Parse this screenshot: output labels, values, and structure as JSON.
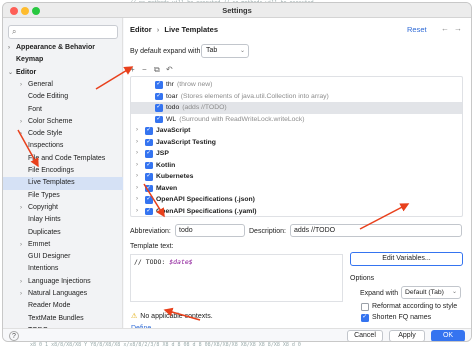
{
  "window": {
    "title": "Settings",
    "bg_top_text": "// no methods will be executed // so methods will be executed",
    "bg_bottom_text": "x8  0  1  x8/8/X8/X8 Y Y8/8/X8/X8  x/x8/8/2/3/8  X8 d 8 08 d 8 08/X8/X8/X8 X8/X8 X8 8/X8 X8 d 0"
  },
  "sidebar": {
    "search_placeholder": "",
    "items": [
      {
        "label": "Appearance & Behavior",
        "bold": true,
        "chevron": "›",
        "indent": 0
      },
      {
        "label": "Keymap",
        "bold": true,
        "chevron": "",
        "indent": 0
      },
      {
        "label": "Editor",
        "bold": true,
        "chevron": "⌄",
        "indent": 0
      },
      {
        "label": "General",
        "bold": false,
        "chevron": "›",
        "indent": 1
      },
      {
        "label": "Code Editing",
        "bold": false,
        "chevron": "",
        "indent": 1
      },
      {
        "label": "Font",
        "bold": false,
        "chevron": "",
        "indent": 1
      },
      {
        "label": "Color Scheme",
        "bold": false,
        "chevron": "›",
        "indent": 1
      },
      {
        "label": "Code Style",
        "bold": false,
        "chevron": "›",
        "indent": 1
      },
      {
        "label": "Inspections",
        "bold": false,
        "chevron": "",
        "indent": 1
      },
      {
        "label": "File and Code Templates",
        "bold": false,
        "chevron": "",
        "indent": 1
      },
      {
        "label": "File Encodings",
        "bold": false,
        "chevron": "",
        "indent": 1
      },
      {
        "label": "Live Templates",
        "bold": false,
        "chevron": "",
        "indent": 1,
        "selected": true
      },
      {
        "label": "File Types",
        "bold": false,
        "chevron": "",
        "indent": 1
      },
      {
        "label": "Copyright",
        "bold": false,
        "chevron": "›",
        "indent": 1
      },
      {
        "label": "Inlay Hints",
        "bold": false,
        "chevron": "",
        "indent": 1
      },
      {
        "label": "Duplicates",
        "bold": false,
        "chevron": "",
        "indent": 1
      },
      {
        "label": "Emmet",
        "bold": false,
        "chevron": "›",
        "indent": 1
      },
      {
        "label": "GUI Designer",
        "bold": false,
        "chevron": "",
        "indent": 1
      },
      {
        "label": "Intentions",
        "bold": false,
        "chevron": "",
        "indent": 1
      },
      {
        "label": "Language Injections",
        "bold": false,
        "chevron": "›",
        "indent": 1
      },
      {
        "label": "Natural Languages",
        "bold": false,
        "chevron": "›",
        "indent": 1
      },
      {
        "label": "Reader Mode",
        "bold": false,
        "chevron": "",
        "indent": 1
      },
      {
        "label": "TextMate Bundles",
        "bold": false,
        "chevron": "",
        "indent": 1
      },
      {
        "label": "TODO",
        "bold": false,
        "chevron": "",
        "indent": 1
      }
    ]
  },
  "main": {
    "breadcrumb_parent": "Editor",
    "breadcrumb_sep": "›",
    "breadcrumb_current": "Live Templates",
    "reset_label": "Reset",
    "expand_label": "By default expand with",
    "expand_value": "Tab",
    "toolbar": {
      "add": "+",
      "remove": "−",
      "copy": "⧉",
      "restore": "↶"
    },
    "templates": [
      {
        "kind": "item",
        "name": "thr",
        "desc": "(throw new)",
        "checked": true
      },
      {
        "kind": "item",
        "name": "toar",
        "desc": "(Stores elements of java.util.Collection into array)",
        "checked": true
      },
      {
        "kind": "item",
        "name": "todo",
        "desc": "(adds //TODO)",
        "checked": true,
        "selected": true
      },
      {
        "kind": "item",
        "name": "WL",
        "desc": "(Surround with ReadWriteLock.writeLock)",
        "checked": true
      },
      {
        "kind": "group",
        "name": "JavaScript",
        "checked": true
      },
      {
        "kind": "group",
        "name": "JavaScript Testing",
        "checked": true
      },
      {
        "kind": "group",
        "name": "JSP",
        "checked": true
      },
      {
        "kind": "group",
        "name": "Kotlin",
        "checked": true
      },
      {
        "kind": "group",
        "name": "Kubernetes",
        "checked": true
      },
      {
        "kind": "group",
        "name": "Maven",
        "checked": true
      },
      {
        "kind": "group",
        "name": "OpenAPI Specifications (.json)",
        "checked": true
      },
      {
        "kind": "group",
        "name": "OpenAPI Specifications (.yaml)",
        "checked": true
      }
    ],
    "abbreviation_label": "Abbreviation:",
    "abbreviation_value": "todo",
    "description_label": "Description:",
    "description_value": "adds //TODO",
    "template_text_label": "Template text:",
    "template_text_prefix": "// TODO: ",
    "template_text_var": "$date$",
    "edit_variables_label": "Edit Variables...",
    "options_title": "Options",
    "expand_with_label": "Expand with",
    "expand_with_value": "Default (Tab)",
    "reformat_label": "Reformat according to style",
    "reformat_checked": false,
    "shorten_label": "Shorten FQ names",
    "shorten_checked": true,
    "warning_text": "No applicable contexts.",
    "warning_icon": "warning-icon",
    "define_label": "Define",
    "define_chevron": "⌄"
  },
  "footer": {
    "help": "?",
    "cancel": "Cancel",
    "apply": "Apply",
    "ok": "OK"
  },
  "colors": {
    "accent": "#3574f0",
    "annotation_arrow": "#e8401c",
    "selection": "#d5e1f5"
  }
}
